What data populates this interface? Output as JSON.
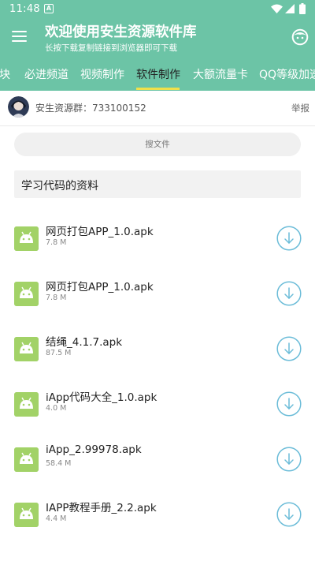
{
  "status_bar": {
    "time": "11:48",
    "notification_glyph": "A",
    "icons": [
      "wifi-icon",
      "signal-icon",
      "battery-icon"
    ]
  },
  "header": {
    "title": "欢迎使用安生资源软件库",
    "subtitle": "长按下载复制链接到浏览器即可下载",
    "background_color": "#6cc4a6",
    "icons": [
      "menu-icon",
      "face-icon"
    ]
  },
  "tabs": [
    {
      "label": "块"
    },
    {
      "label": "必进频道"
    },
    {
      "label": "视频制作"
    },
    {
      "label": "软件制作",
      "active": true
    },
    {
      "label": "大额流量卡"
    },
    {
      "label": "QQ等级加速"
    }
  ],
  "tab_underline_color": "#f0e04a",
  "group": {
    "label": "安生资源群：733100152",
    "report_label": "举报"
  },
  "search": {
    "placeholder": "搜文件"
  },
  "category": {
    "title": "学习代码的资料"
  },
  "files": [
    {
      "name": "网页打包APP_1.0.apk",
      "size": "7.8 M"
    },
    {
      "name": "网页打包APP_1.0.apk",
      "size": "7.8 M"
    },
    {
      "name": "结绳_4.1.7.apk",
      "size": "87.5 M"
    },
    {
      "name": "iApp代码大全_1.0.apk",
      "size": "4.0 M"
    },
    {
      "name": "iApp_2.99978.apk",
      "size": "58.4 M"
    },
    {
      "name": "IAPP教程手册_2.2.apk",
      "size": "4.4 M"
    }
  ],
  "file_icon": "android-icon",
  "file_icon_color": "#a2d267",
  "download_icon": "download-icon",
  "download_color": "#6bbcd8"
}
